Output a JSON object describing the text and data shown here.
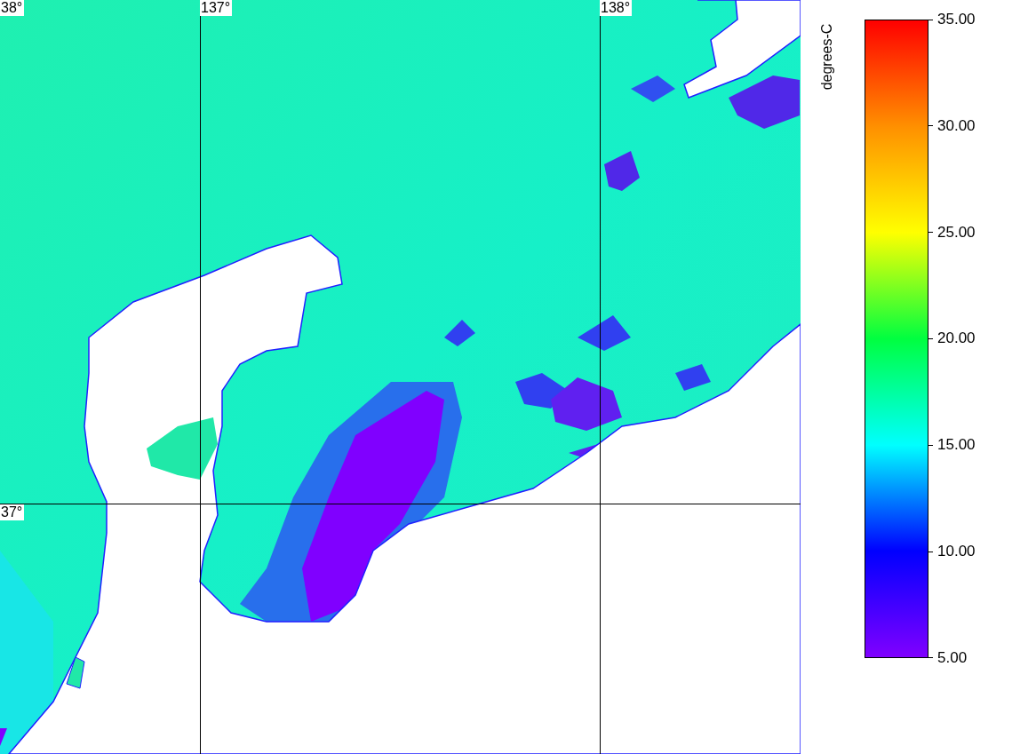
{
  "map": {
    "grid_labels": [
      {
        "text": "38°",
        "kind": "lat"
      },
      {
        "text": "137°",
        "kind": "lon"
      },
      {
        "text": "138°",
        "kind": "lon"
      },
      {
        "text": "37°",
        "kind": "lat"
      }
    ]
  },
  "colorbar": {
    "title": "degrees-C",
    "ticks": [
      "35.00",
      "30.00",
      "25.00",
      "20.00",
      "15.00",
      "10.00",
      "5.00"
    ]
  }
}
